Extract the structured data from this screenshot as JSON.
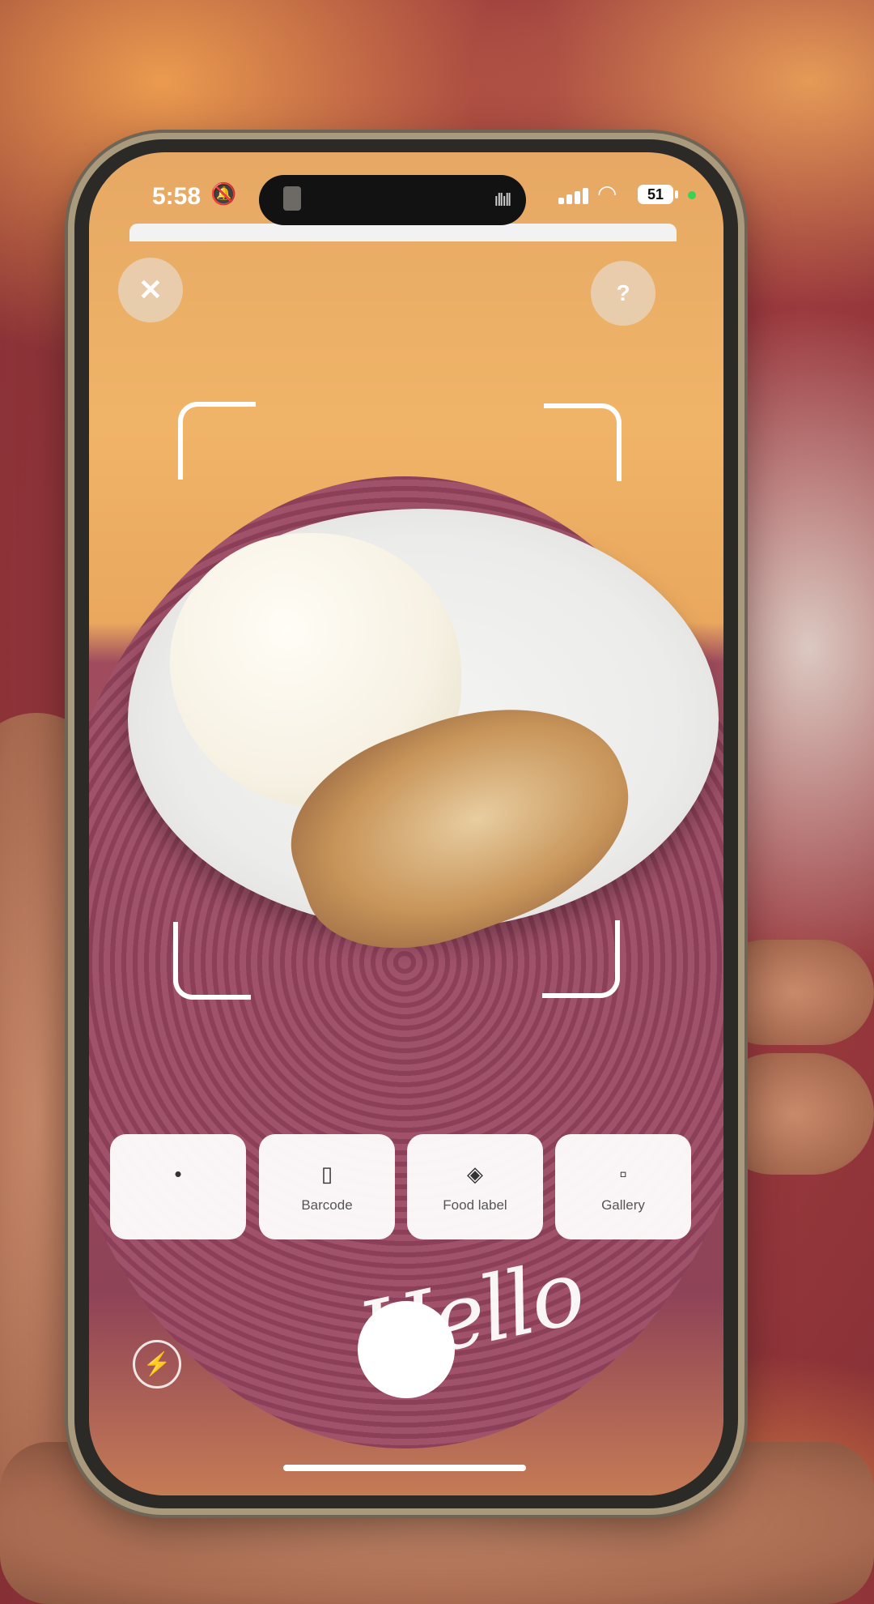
{
  "status_bar": {
    "time": "5:58",
    "bell_icon": "bell-slash-icon",
    "battery": "51",
    "island_indicator": "ıllıll"
  },
  "camera": {
    "close_icon": "✕",
    "help_icon": "?",
    "flash_icon": "⚡"
  },
  "modes": [
    {
      "label": "",
      "icon": "•"
    },
    {
      "label": "Barcode",
      "icon": "▯"
    },
    {
      "label": "Food label",
      "icon": "◈"
    },
    {
      "label": "Gallery",
      "icon": "▫"
    }
  ],
  "overlay_text": "Hello"
}
